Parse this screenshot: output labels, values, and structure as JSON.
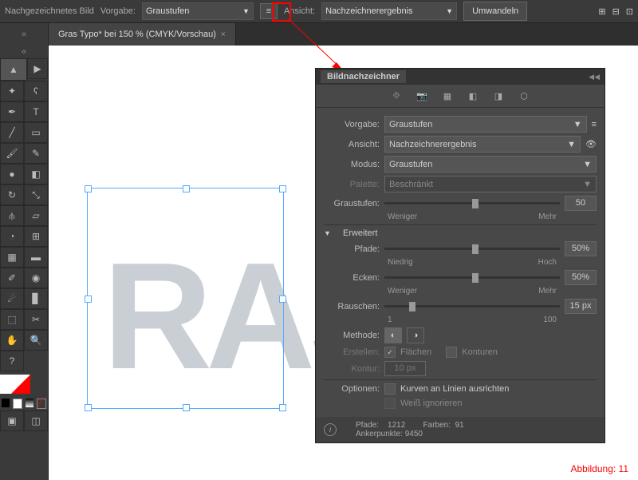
{
  "topbar": {
    "title": "Nachgezeichnetes Bild",
    "vorgabe_label": "Vorgabe:",
    "vorgabe_value": "Graustufen",
    "ansicht_label": "Ansicht:",
    "ansicht_value": "Nachzeichnerergebnis",
    "convert": "Umwandeln"
  },
  "tab": {
    "title": "Gras Typo* bei 150 % (CMYK/Vorschau)"
  },
  "canvas": {
    "text": "RASEN"
  },
  "panel": {
    "title": "Bildnachzeichner",
    "vorgabe": {
      "l": "Vorgabe:",
      "v": "Graustufen"
    },
    "ansicht": {
      "l": "Ansicht:",
      "v": "Nachzeichnerergebnis"
    },
    "modus": {
      "l": "Modus:",
      "v": "Graustufen"
    },
    "palette": {
      "l": "Palette:",
      "v": "Beschränkt"
    },
    "graustufen": {
      "l": "Graustufen:",
      "v": "50",
      "min": "Weniger",
      "max": "Mehr"
    },
    "erweitert": "Erweitert",
    "pfade": {
      "l": "Pfade:",
      "v": "50%",
      "min": "Niedrig",
      "max": "Hoch"
    },
    "ecken": {
      "l": "Ecken:",
      "v": "50%",
      "min": "Weniger",
      "max": "Mehr"
    },
    "rauschen": {
      "l": "Rauschen:",
      "v": "15 px",
      "min": "1",
      "max": "100"
    },
    "methode": "Methode:",
    "erstellen": {
      "l": "Erstellen:",
      "a": "Flächen",
      "b": "Konturen"
    },
    "kontur": {
      "l": "Kontur:",
      "v": "10 px"
    },
    "optionen": {
      "l": "Optionen:",
      "a": "Kurven an Linien ausrichten",
      "b": "Weiß ignorieren"
    },
    "stats": {
      "pfade_l": "Pfade:",
      "pfade_v": "1212",
      "farben_l": "Farben:",
      "farben_v": "91",
      "anker_l": "Ankerpunkte:",
      "anker_v": "9450"
    }
  },
  "caption": "Abbildung: 11"
}
